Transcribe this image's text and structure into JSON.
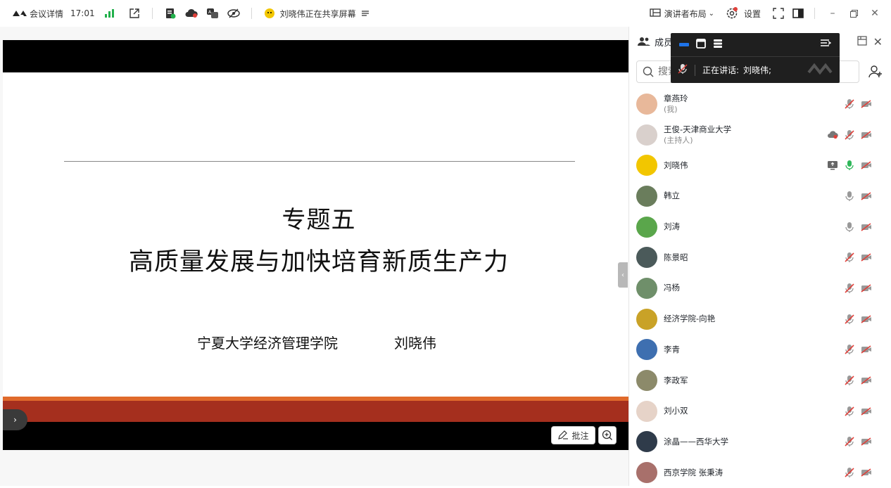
{
  "topbar": {
    "meeting_details": "会议详情",
    "time": "17:01",
    "sharing_text": "刘晓伟正在共享屏幕",
    "layout_label": "演讲者布局",
    "settings_label": "设置"
  },
  "slide": {
    "title_line1": "专题五",
    "title_line2": "高质量发展与加快培育新质生产力",
    "institution": "宁夏大学经济管理学院",
    "author": "刘晓伟"
  },
  "stage_controls": {
    "annotate_label": "批注"
  },
  "panel": {
    "title": "成员",
    "search_placeholder": "搜索",
    "speaking_label": "正在讲话:",
    "speaking_name": "刘晓伟;",
    "members": [
      {
        "name": "章燕玲",
        "sub": "(我)",
        "avatar_color": "#e8b89a",
        "mic": "muted",
        "cam": "off",
        "extra": ""
      },
      {
        "name": "王俊-天津商业大学",
        "sub": "(主持人)",
        "avatar_color": "#d9d0cc",
        "mic": "muted",
        "cam": "off",
        "extra": "cloud-recording-icon"
      },
      {
        "name": "刘晓伟",
        "sub": "",
        "avatar_color": "#f2c600",
        "mic": "active",
        "cam": "off",
        "extra": "screen-share-icon"
      },
      {
        "name": "韩立",
        "sub": "",
        "avatar_color": "#6a7d5c",
        "mic": "on",
        "cam": "off",
        "extra": ""
      },
      {
        "name": "刘涛",
        "sub": "",
        "avatar_color": "#5aa64b",
        "mic": "on",
        "cam": "off",
        "extra": ""
      },
      {
        "name": "陈景昭",
        "sub": "",
        "avatar_color": "#4b5a5a",
        "mic": "muted",
        "cam": "off",
        "extra": ""
      },
      {
        "name": "冯杨",
        "sub": "",
        "avatar_color": "#6f8f6a",
        "mic": "muted",
        "cam": "off",
        "extra": ""
      },
      {
        "name": "经济学院-向艳",
        "sub": "",
        "avatar_color": "#c9a227",
        "mic": "muted",
        "cam": "off",
        "extra": ""
      },
      {
        "name": "李青",
        "sub": "",
        "avatar_color": "#3e6fb0",
        "mic": "muted",
        "cam": "off",
        "extra": ""
      },
      {
        "name": "李政军",
        "sub": "",
        "avatar_color": "#8c8a6a",
        "mic": "muted",
        "cam": "off",
        "extra": ""
      },
      {
        "name": "刘小双",
        "sub": "",
        "avatar_color": "#e6d3c8",
        "mic": "muted",
        "cam": "off",
        "extra": ""
      },
      {
        "name": "涂晶——西华大学",
        "sub": "",
        "avatar_color": "#2f3b4a",
        "mic": "muted",
        "cam": "off",
        "extra": ""
      },
      {
        "name": "西京学院 张秉涛",
        "sub": "",
        "avatar_color": "#a8706b",
        "mic": "muted",
        "cam": "off",
        "extra": ""
      }
    ]
  },
  "colors": {
    "accent_blue": "#1e73e8",
    "signal_green": "#22b14c",
    "mic_active_green": "#2fb75a",
    "muted_red": "#e0403a",
    "slide_orange": "#e06a2b",
    "slide_red": "#a52f1e"
  }
}
